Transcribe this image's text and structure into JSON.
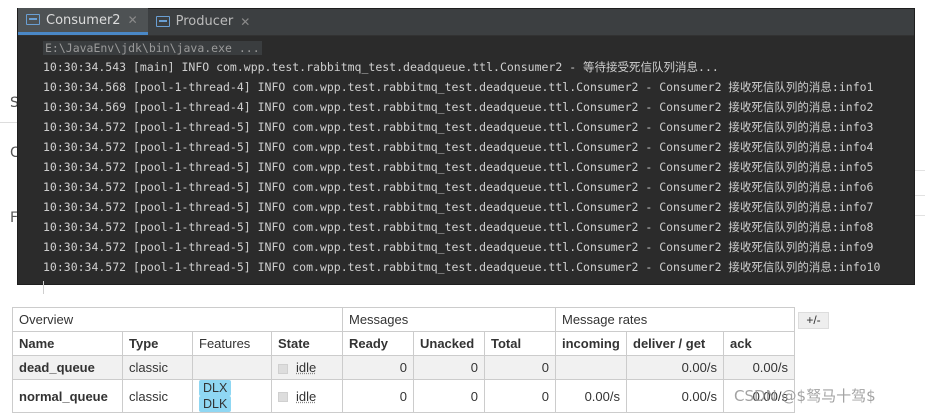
{
  "ide": {
    "tabs": [
      {
        "label": "Consumer2",
        "active": true
      },
      {
        "label": "Producer",
        "active": false
      }
    ],
    "command": "E:\\JavaEnv\\jdk\\bin\\java.exe ...",
    "lines": [
      "10:30:34.543 [main] INFO com.wpp.test.rabbitmq_test.deadqueue.ttl.Consumer2 - 等待接受死信队列消息...",
      "10:30:34.568 [pool-1-thread-4] INFO com.wpp.test.rabbitmq_test.deadqueue.ttl.Consumer2 - Consumer2 接收死信队列的消息:info1",
      "10:30:34.569 [pool-1-thread-4] INFO com.wpp.test.rabbitmq_test.deadqueue.ttl.Consumer2 - Consumer2 接收死信队列的消息:info2",
      "10:30:34.572 [pool-1-thread-5] INFO com.wpp.test.rabbitmq_test.deadqueue.ttl.Consumer2 - Consumer2 接收死信队列的消息:info3",
      "10:30:34.572 [pool-1-thread-5] INFO com.wpp.test.rabbitmq_test.deadqueue.ttl.Consumer2 - Consumer2 接收死信队列的消息:info4",
      "10:30:34.572 [pool-1-thread-5] INFO com.wpp.test.rabbitmq_test.deadqueue.ttl.Consumer2 - Consumer2 接收死信队列的消息:info5",
      "10:30:34.572 [pool-1-thread-5] INFO com.wpp.test.rabbitmq_test.deadqueue.ttl.Consumer2 - Consumer2 接收死信队列的消息:info6",
      "10:30:34.572 [pool-1-thread-5] INFO com.wpp.test.rabbitmq_test.deadqueue.ttl.Consumer2 - Consumer2 接收死信队列的消息:info7",
      "10:30:34.572 [pool-1-thread-5] INFO com.wpp.test.rabbitmq_test.deadqueue.ttl.Consumer2 - Consumer2 接收死信队列的消息:info8",
      "10:30:34.572 [pool-1-thread-5] INFO com.wpp.test.rabbitmq_test.deadqueue.ttl.Consumer2 - Consumer2 接收死信队列的消息:info9",
      "10:30:34.572 [pool-1-thread-5] INFO com.wpp.test.rabbitmq_test.deadqueue.ttl.Consumer2 - Consumer2 接收死信队列的消息:info10"
    ]
  },
  "queues": {
    "groups": [
      "Overview",
      "Messages",
      "Message rates"
    ],
    "toggle": "+/-",
    "headers": [
      "Name",
      "Type",
      "Features",
      "State",
      "Ready",
      "Unacked",
      "Total",
      "incoming",
      "deliver / get",
      "ack"
    ],
    "rows": [
      {
        "name": "dead_queue",
        "type": "classic",
        "features": [],
        "state": "idle",
        "ready": "0",
        "unacked": "0",
        "total": "0",
        "incoming": "",
        "deliver_get": "0.00/s",
        "ack": "0.00/s"
      },
      {
        "name": "normal_queue",
        "type": "classic",
        "features": [
          "DLX",
          "DLK"
        ],
        "state": "idle",
        "ready": "0",
        "unacked": "0",
        "total": "0",
        "incoming": "0.00/s",
        "deliver_get": "0.00/s",
        "ack": "0.00/s"
      }
    ]
  },
  "watermark": "CSDN @$驽马十驾$",
  "colors": {
    "ide_bg": "#2b2b2b",
    "tab_accent": "#4a88c7",
    "badge": "#8fd7f3"
  }
}
